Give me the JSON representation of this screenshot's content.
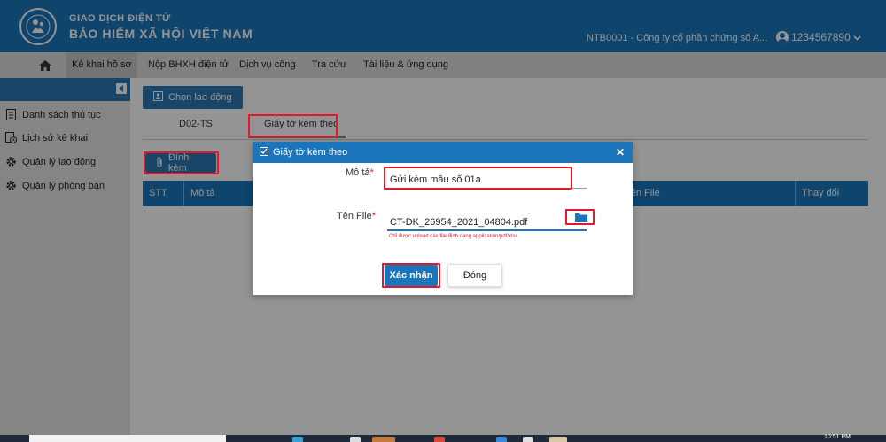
{
  "header": {
    "brand_top": "GIAO DỊCH ĐIỆN TỬ",
    "brand_main": "BẢO HIỂM XÃ HỘI VIỆT NAM",
    "company": "NTB0001 - Công ty cổ phần chứng số A...",
    "user": "1234567890",
    "color": "#1a75bb"
  },
  "nav": {
    "items": [
      {
        "label": "Kê khai hồ sơ",
        "active": true
      },
      {
        "label": "Nộp BHXH điện tử"
      },
      {
        "label": "Dịch vụ công"
      },
      {
        "label": "Tra cứu"
      },
      {
        "label": "Tài liệu & ứng dụng"
      }
    ]
  },
  "sidebar": {
    "items": [
      {
        "label": "Danh sách thủ tục",
        "icon": "document-list-icon"
      },
      {
        "label": "Lịch sử kê khai",
        "icon": "history-icon"
      },
      {
        "label": "Quản lý lao động",
        "icon": "gear-icon"
      },
      {
        "label": "Quản lý phòng ban",
        "icon": "gear-icon"
      }
    ]
  },
  "main": {
    "choose_button": "Chọn lao động",
    "tabs": [
      {
        "label": "D02-TS"
      },
      {
        "label": "Giấy tờ kèm theo",
        "active": true
      }
    ],
    "attach_button": "Đính kèm",
    "table_headers": [
      "STT",
      "Mô tả",
      "Tên File",
      "Thay đổi"
    ]
  },
  "modal": {
    "title": "Giấy tờ kèm theo",
    "description_label": "Mô tả",
    "description_value": "Gửi kèm mẫu số 01a",
    "file_label": "Tên File",
    "file_value": "CT-DK_26954_2021_04804.pdf",
    "hint": "Chỉ được upload các file định dạng application/pdf/xlsx",
    "confirm_button": "Xác nhận",
    "close_button": "Đóng"
  },
  "taskbar": {
    "clock": "10:51 PM"
  },
  "colors": {
    "highlight_red": "#e3182d",
    "primary_blue": "#1a75bb"
  }
}
